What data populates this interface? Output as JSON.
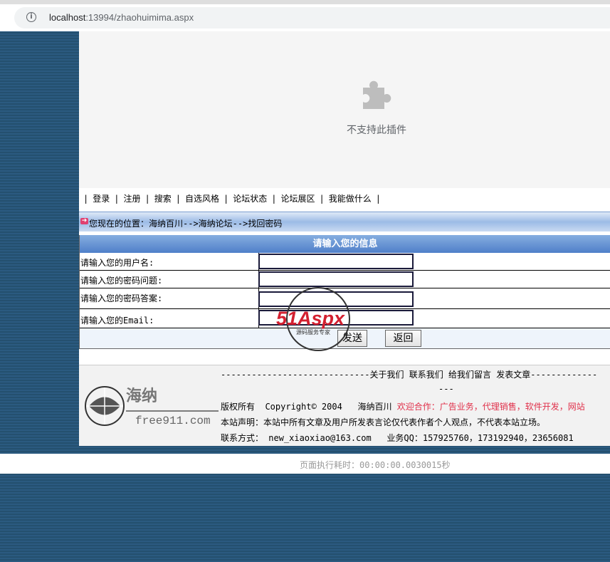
{
  "browser": {
    "url_host": "localhost",
    "url_rest": ":13994/zhaohuimima.aspx"
  },
  "plugin": {
    "message": "不支持此插件"
  },
  "nav": {
    "items": [
      "登录",
      "注册",
      "搜索",
      "自选风格",
      "论坛状态",
      "论坛展区",
      "我能做什么"
    ]
  },
  "location": {
    "text": "您现在的位置：海纳百川-->海纳论坛-->找回密码"
  },
  "form": {
    "header": "请输入您的信息",
    "fields": [
      {
        "label": "请输入您的用户名:",
        "value": ""
      },
      {
        "label": "请输入您的密码问题:",
        "value": ""
      },
      {
        "label": "请输入您的密码答案:",
        "value": ""
      },
      {
        "label": "请输入您的Email:",
        "value": ""
      }
    ],
    "submit_label": "发送",
    "back_label": "返回"
  },
  "watermark": {
    "brand": "51Aspx",
    "sub": "源码服务专家"
  },
  "footer": {
    "logo_text": "海纳",
    "logo_domain": "free911.com",
    "links_prefix": "-----------------------------",
    "links": [
      "关于我们",
      "联系我们",
      "给我们留言",
      "发表文章"
    ],
    "links_suffix": "-------------",
    "links_tail": "---",
    "copyright": "版权所有  Copyright© 2004   海纳百川",
    "welcome": "欢迎合作：广告业务，代理销售，软件开发，网站",
    "statement": "本站声明：本站中所有文章及用户所发表言论仅代表作者个人观点，不代表本站立场。",
    "contact": "联系方式： new_xiaoxiao@163.com   业务QQ：157925760，173192940，23656081"
  },
  "timing": {
    "text": "页面执行耗时：00:00:00.0030015秒"
  },
  "colors": {
    "background": "#2b5a80",
    "header_blue": "#4f7fc9",
    "accent_red": "#e0304a"
  }
}
